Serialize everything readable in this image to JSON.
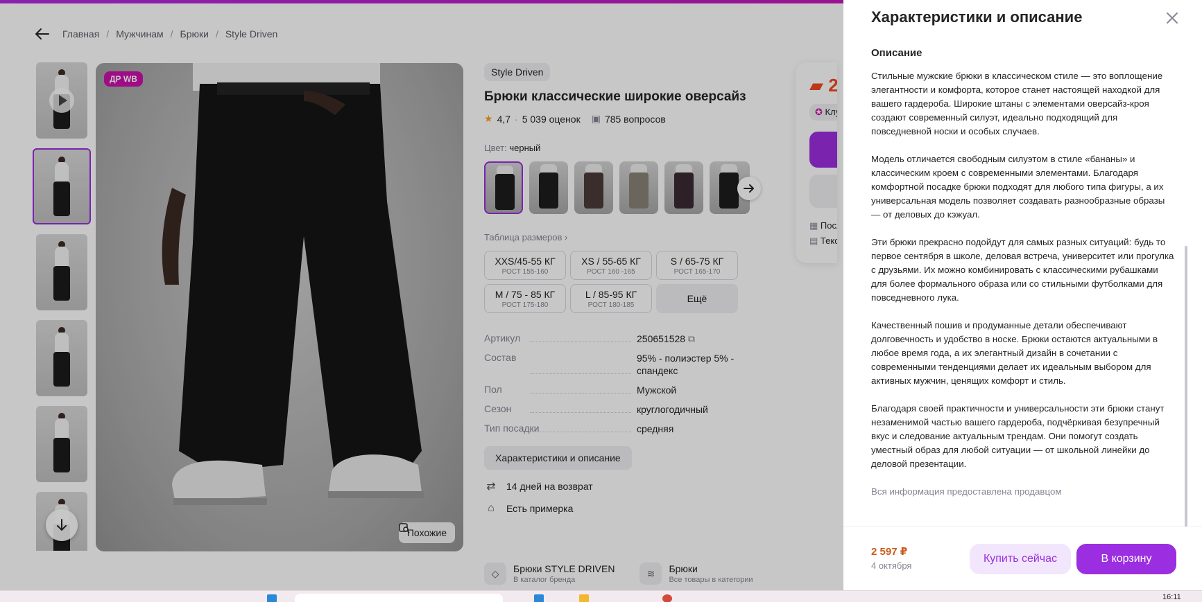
{
  "breadcrumbs": [
    "Главная",
    "Мужчинам",
    "Брюки",
    "Style Driven"
  ],
  "gallery": {
    "badge": "ДР WB",
    "similar_label": "Похожие"
  },
  "product": {
    "brand": "Style Driven",
    "title": "Брюки классические широкие оверсайз",
    "rating": "4,7",
    "reviews": "5 039 оценок",
    "questions": "785 вопросов",
    "color_label": "Цвет:",
    "color_value": "черный",
    "size_table_label": "Таблица размеров",
    "sizes": [
      {
        "main": "XXS/45-55 КГ",
        "sub": "РОСТ 155-160"
      },
      {
        "main": "XS / 55-65 КГ",
        "sub": "РОСТ 160 -165"
      },
      {
        "main": "S / 65-75 КГ",
        "sub": "РОСТ 165-170"
      },
      {
        "main": "M / 75 - 85 КГ",
        "sub": "РОСТ 175-180"
      },
      {
        "main": "L / 85-95 КГ",
        "sub": "РОСТ 180-185"
      }
    ],
    "more_sizes_label": "Ещё",
    "specs": [
      {
        "key": "Артикул",
        "value": "250651528"
      },
      {
        "key": "Состав",
        "value": "95% - полиэстер 5% - спандекс"
      },
      {
        "key": "Пол",
        "value": "Мужской"
      },
      {
        "key": "Сезон",
        "value": "круглогодичный"
      },
      {
        "key": "Тип посадки",
        "value": "средняя"
      }
    ],
    "desc_button": "Характеристики и описание",
    "features": [
      "14 дней на возврат",
      "Есть примерка"
    ],
    "brand_links": [
      {
        "title": "Брюки STYLE DRIVEN",
        "subtitle": "В каталог бренда"
      },
      {
        "title": "Брюки",
        "subtitle": "Все товары в категории"
      }
    ]
  },
  "buybox": {
    "price_partial": "2",
    "club_partial": "Клу",
    "line1": "Посл",
    "line2": "Текс"
  },
  "panel": {
    "title": "Характеристики и описание",
    "section": "Описание",
    "paragraphs": [
      "Стильные мужские брюки в классическом стиле — это воплощение элегантности и комфорта, которое станет настоящей находкой для вашего гардероба. Широкие штаны с элементами оверсайз-кроя создают современный силуэт, идеально подходящий для повседневной носки и особых случаев.",
      "Модель отличается свободным силуэтом в стиле «бананы» и классическим кроем с современными элементами. Благодаря комфортной посадке брюки подходят для любого типа фигуры, а их универсальная модель позволяет создавать разнообразные образы — от деловых до кэжуал.",
      "Эти брюки прекрасно подойдут для самых разных ситуаций: будь то первое сентября в школе, деловая встреча, университет или прогулка с друзьями. Их можно комбинировать с классическими рубашками для более формального образа или со стильными футболками для повседневного лука.",
      "Качественный пошив и продуманные детали обеспечивают долговечность и удобство в носке. Брюки остаются актуальными в любое время года, а их элегантный дизайн в сочетании с современными тенденциями делает их идеальным выбором для активных мужчин, ценящих комфорт и стиль.",
      "Благодаря своей практичности и универсальности эти брюки станут незаменимой частью вашего гардероба, подчёркивая безупречный вкус и следование актуальным трендам. Они помогут создать уместный образ для любой ситуации — от школьной линейки до деловой презентации."
    ],
    "note": "Вся информация предоставлена продавцом",
    "price": "2 597 ₽",
    "date": "4 октября",
    "buy_now": "Купить сейчас",
    "to_cart": "В корзину"
  },
  "taskbar": {
    "clock": "16:11"
  },
  "colors": {
    "accent": "#9b2ee0",
    "brand_pink": "#cb11ab",
    "price_orange": "#f04a21"
  }
}
